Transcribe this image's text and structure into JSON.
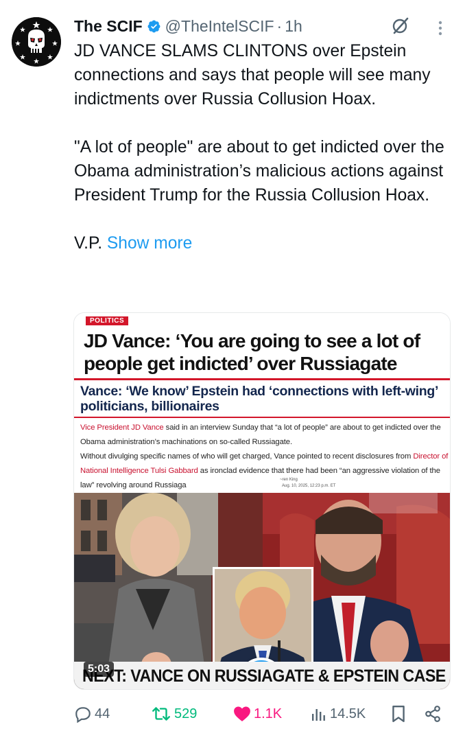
{
  "post": {
    "author_name": "The SCIF",
    "handle": "@TheIntelSCIF",
    "separator": "·",
    "time": "1h",
    "text_p1": "JD VANCE SLAMS CLINTONS over Epstein connections and says that people will see many indictments over Russia Collusion Hoax.",
    "text_p2": "\"A lot of people\" are about to get indicted over the Obama administration’s malicious actions against President Trump for the Russia Collusion Hoax.",
    "text_p3": "V.P.",
    "show_more": "Show more"
  },
  "media": {
    "article": {
      "tag": "POLITICS",
      "headline": "JD Vance: ‘You are going to see a lot of people get indicted’ over Russiagate",
      "subhead": "Vance: ‘We know’ Epstein had ‘connections with left-wing’ politicians, billionaires",
      "body_1_red": "Vice President JD Vance",
      "body_1": " said in an interview Sunday that “a lot of people” are about to get indicted over the Obama administration’s machinations on so-called Russiagate.",
      "body_2": "Without divulging specific names of who will get charged, Vance pointed to recent disclosures from ",
      "body_2_red": "Director of National Intelligence Tulsi Gabbard",
      "body_2b": " as ironclad evidence that there had been “an aggressive violation of the law” revolving around Russiaga",
      "byline": "~ren King",
      "date": "Aug. 10, 2025, 12:23 p.m. ET"
    },
    "video": {
      "duration": "5:03",
      "next_caption": "NEXT: VANCE ON RUSSIAGATE & EPSTEIN CASE"
    }
  },
  "actions": {
    "replies": "44",
    "reposts": "529",
    "likes": "1.1K",
    "views": "14.5K"
  },
  "colors": {
    "accent": "#1d9bf0",
    "repost_green": "#00ba7c",
    "like_pink": "#f91880",
    "muted": "#536471"
  },
  "icons": [
    "verified-badge-icon",
    "grok-icon",
    "more-icon",
    "play-icon",
    "reply-icon",
    "repost-icon",
    "like-icon",
    "views-icon",
    "bookmark-icon",
    "share-icon"
  ]
}
